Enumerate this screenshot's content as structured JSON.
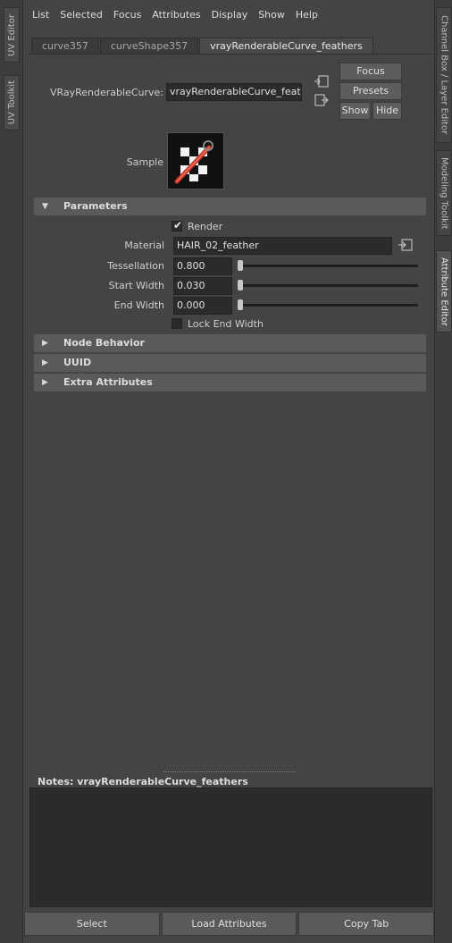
{
  "left_sidebar": {
    "tabs": [
      {
        "label": "UV Editor"
      },
      {
        "label": "UV Toolkit"
      }
    ]
  },
  "right_sidebar": {
    "tabs": [
      {
        "label": "Channel Box / Layer Editor"
      },
      {
        "label": "Modeling Toolkit"
      },
      {
        "label": "Attribute Editor"
      }
    ]
  },
  "menubar": {
    "items": [
      "List",
      "Selected",
      "Focus",
      "Attributes",
      "Display",
      "Show",
      "Help"
    ]
  },
  "node_tabs": [
    "curve357",
    "curveShape357",
    "vrayRenderableCurve_feathers"
  ],
  "header": {
    "node_type_label": "VRayRenderableCurve:",
    "node_name_value": "vrayRenderableCurve_feathers",
    "focus_label": "Focus",
    "presets_label": "Presets",
    "show_label": "Show",
    "hide_label": "Hide",
    "sample_label": "Sample"
  },
  "sections": {
    "parameters": {
      "title": "Parameters",
      "expanded": true,
      "render_label": "Render",
      "render_checked": true,
      "material_label": "Material",
      "material_value": "HAIR_02_feather",
      "tessellation_label": "Tessellation",
      "tessellation_value": "0.800",
      "start_width_label": "Start Width",
      "start_width_value": "0.030",
      "end_width_label": "End Width",
      "end_width_value": "0.000",
      "lock_end_width_label": "Lock End Width",
      "lock_end_width_checked": false
    },
    "node_behavior": {
      "title": "Node Behavior",
      "expanded": false
    },
    "uuid": {
      "title": "UUID",
      "expanded": false
    },
    "extra_attributes": {
      "title": "Extra Attributes",
      "expanded": false
    }
  },
  "notes": {
    "label": "Notes:  vrayRenderableCurve_feathers",
    "text": ""
  },
  "bottom_buttons": {
    "select": "Select",
    "load_attributes": "Load Attributes",
    "copy_tab": "Copy Tab"
  },
  "colors": {
    "background": "#444444",
    "field_bg": "#2b2b2b",
    "section_bg": "#5a5a5a",
    "swatch_accent": "#c0392b"
  }
}
